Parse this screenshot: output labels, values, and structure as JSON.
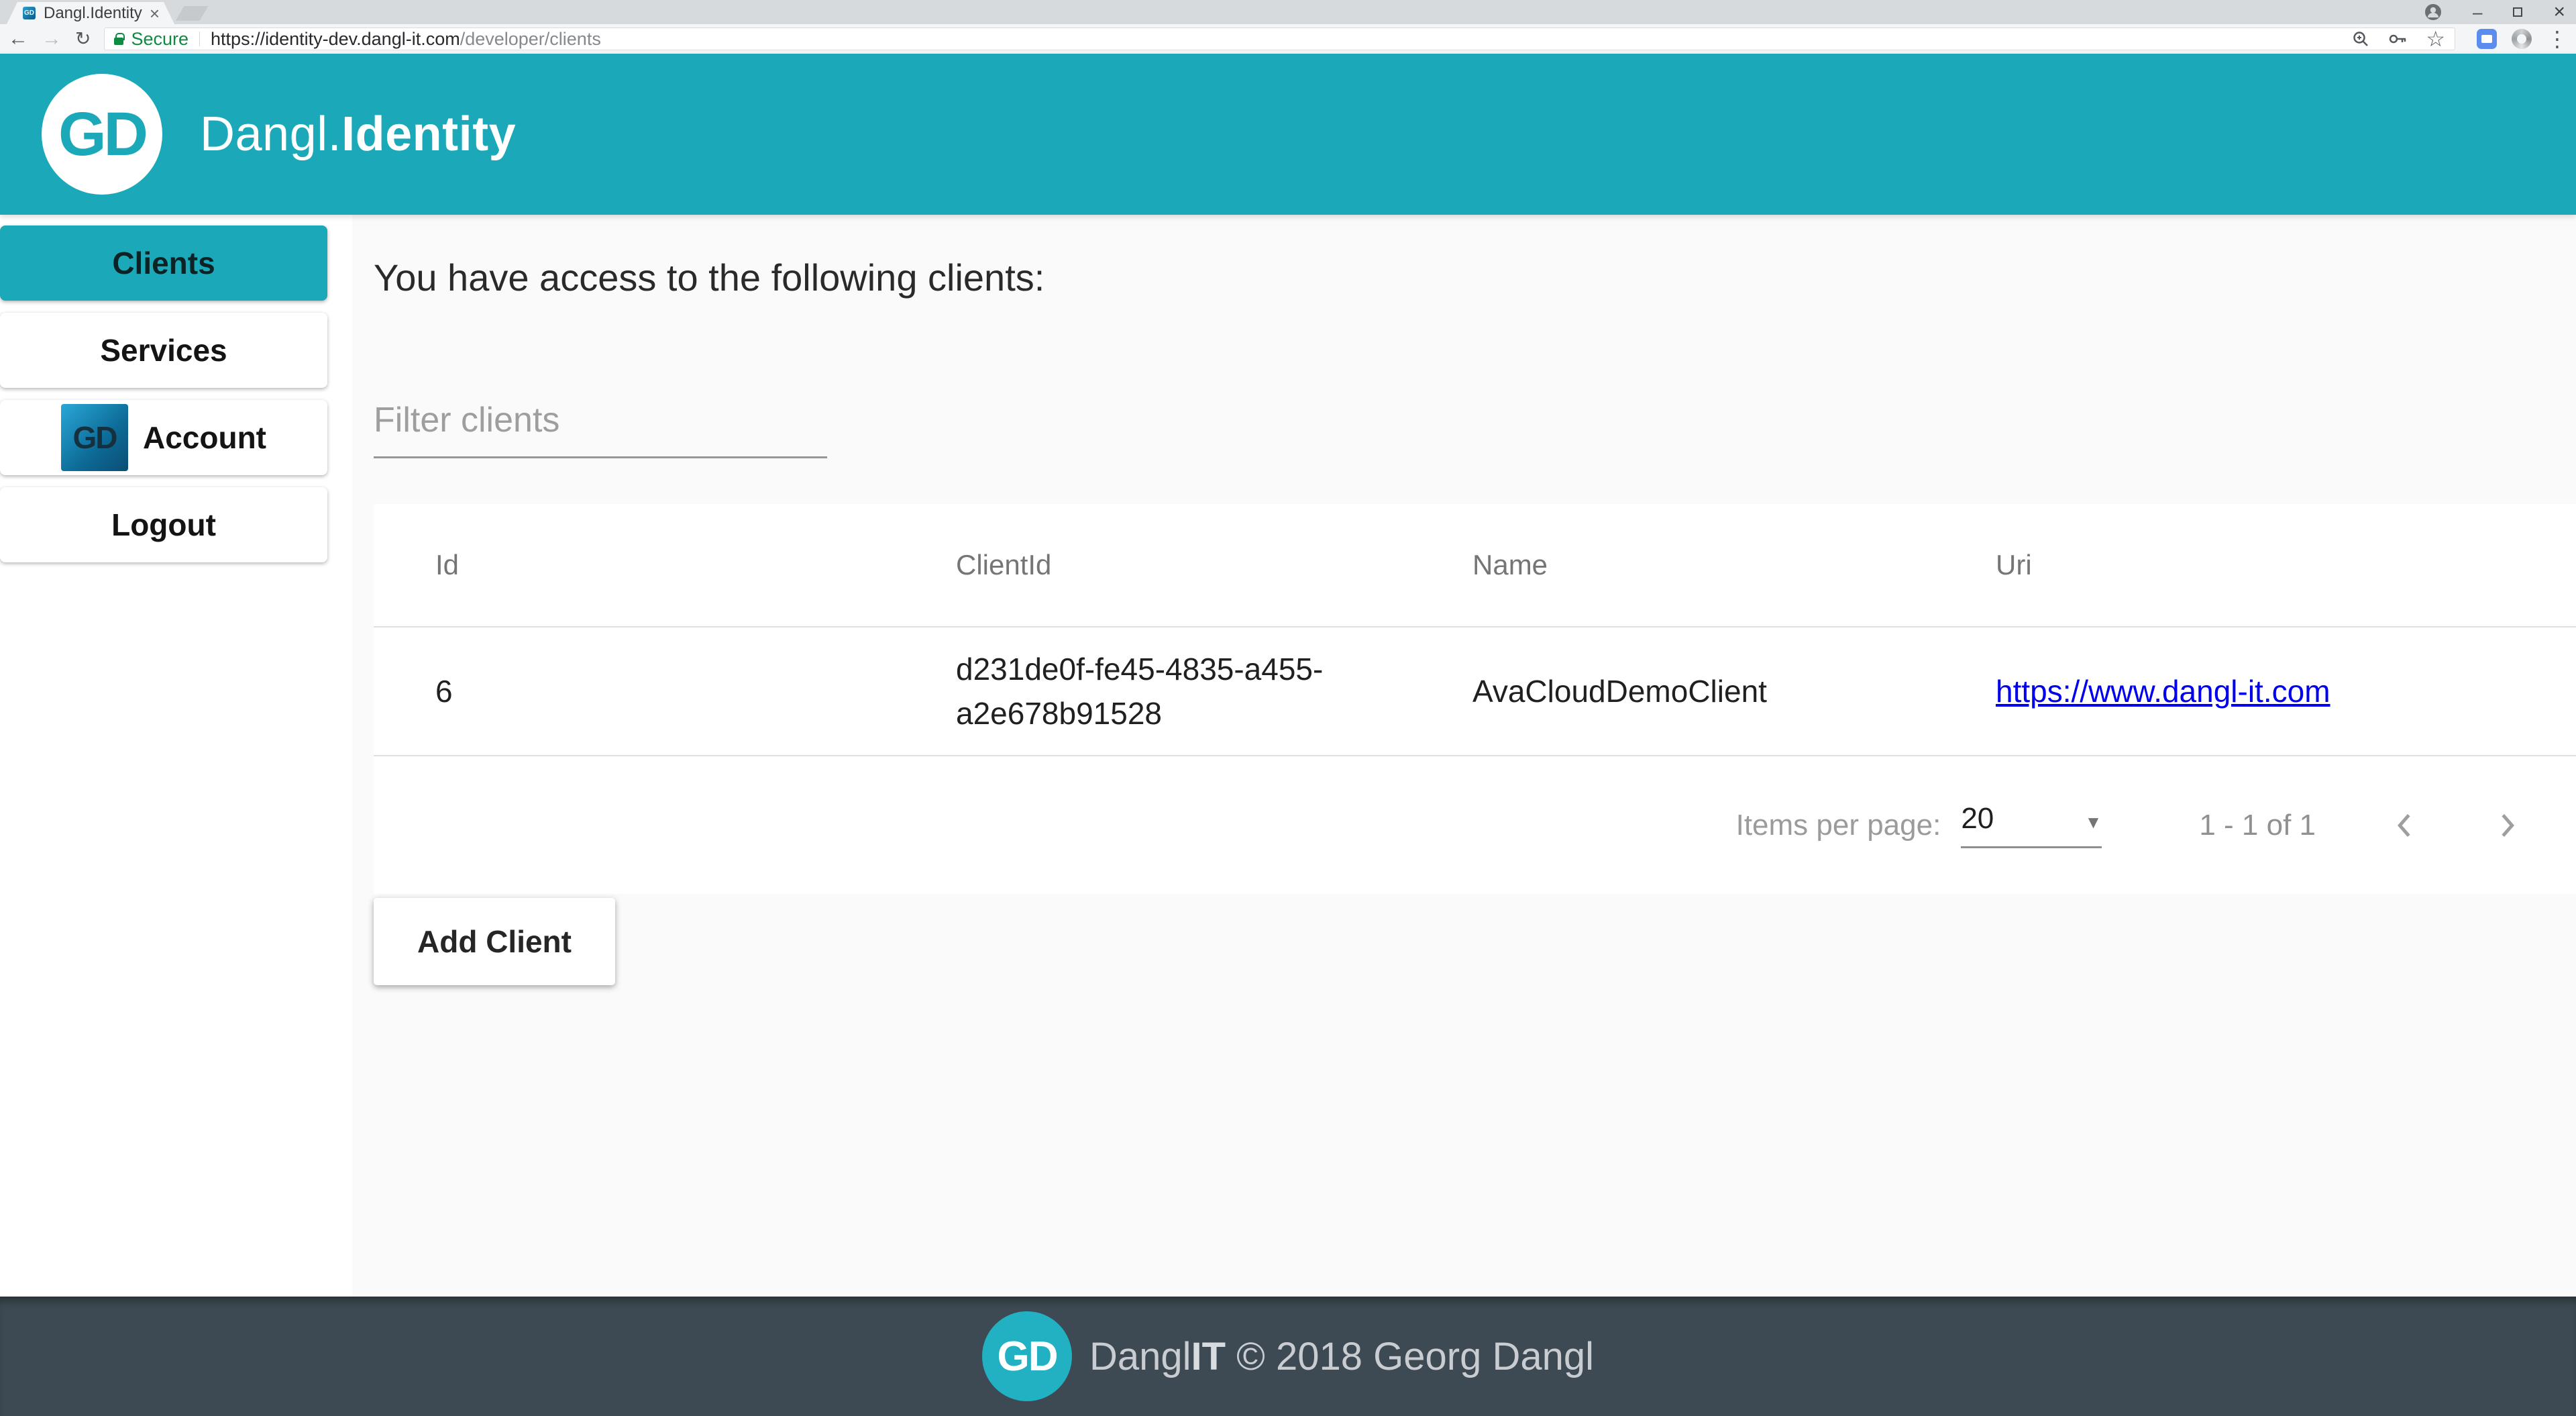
{
  "browser": {
    "tab_title": "Dangl.Identity",
    "security_label": "Secure",
    "url_domain": "https://identity-dev.dangl-it.com",
    "url_path": "/developer/clients",
    "icons": {
      "back": "←",
      "forward": "→",
      "refresh": "↻",
      "star": "☆",
      "menu": "⋮",
      "minimize": "–",
      "close": "×",
      "tab_close": "×"
    }
  },
  "header": {
    "logo_text": "GD",
    "title_regular": "Dangl.",
    "title_bold": "Identity"
  },
  "sidebar": {
    "items": [
      {
        "label": "Clients",
        "active": true
      },
      {
        "label": "Services",
        "active": false
      },
      {
        "label": "Account",
        "active": false,
        "icon_text": "GD"
      },
      {
        "label": "Logout",
        "active": false
      }
    ]
  },
  "main": {
    "heading": "You have access to the following clients:",
    "filter_placeholder": "Filter clients",
    "table": {
      "columns": [
        "Id",
        "ClientId",
        "Name",
        "Uri"
      ],
      "rows": [
        {
          "id": "6",
          "client_id": "d231de0f-fe45-4835-a455-a2e678b91528",
          "name": "AvaCloudDemoClient",
          "uri": "https://www.dangl-it.com"
        }
      ]
    },
    "paginator": {
      "items_per_page_label": "Items per page:",
      "page_size": "20",
      "caret": "▼",
      "range": "1 - 1 of 1"
    },
    "add_button": "Add Client"
  },
  "footer": {
    "logo_text": "GD",
    "text_regular": "Dangl",
    "text_bold": "IT",
    "text_suffix": " © 2018 Georg Dangl"
  },
  "colors": {
    "accent_teal": "#1ba9b9",
    "footer_background": "#3d4a53",
    "link_blue": "#0000ee",
    "secure_green": "#0e8a43"
  }
}
